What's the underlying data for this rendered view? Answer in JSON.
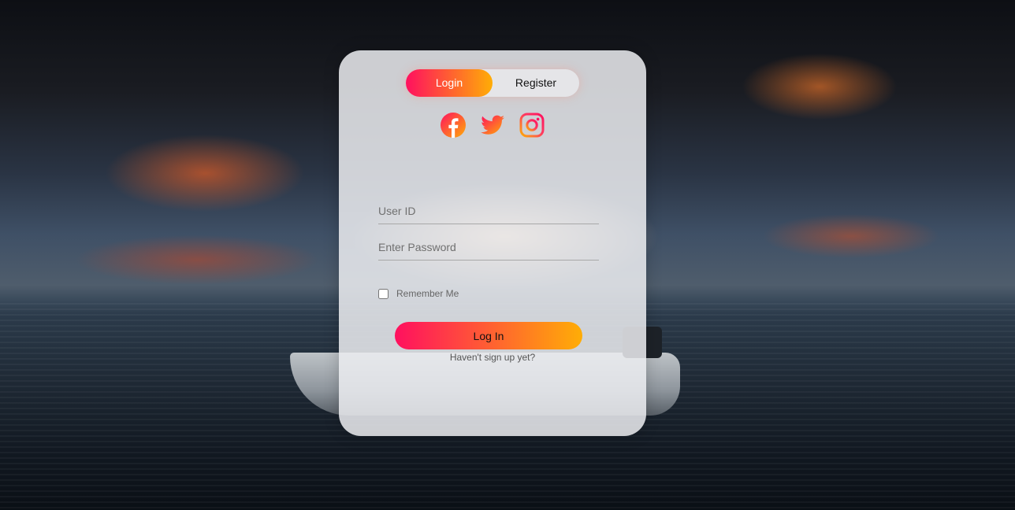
{
  "background": {
    "scene": "sunset-lake-boat-photo"
  },
  "colors": {
    "gradient_start": "#ff105f",
    "gradient_end": "#ffad06",
    "card_bg": "#ebecf0"
  },
  "tabs": {
    "login_label": "Login",
    "register_label": "Register",
    "active": "login"
  },
  "social": {
    "icons": [
      "facebook-icon",
      "twitter-icon",
      "instagram-icon"
    ]
  },
  "form": {
    "user_id_placeholder": "User ID",
    "user_id_value": "",
    "password_placeholder": "Enter Password",
    "password_value": "",
    "remember_label": "Remember Me",
    "remember_checked": false,
    "submit_label": "Log In",
    "signup_link": "Haven't sign up yet?"
  }
}
